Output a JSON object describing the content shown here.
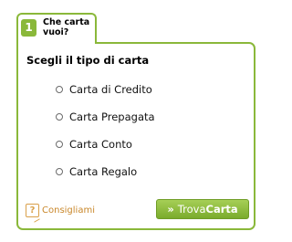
{
  "tab": {
    "step_number": "1",
    "title": "Che carta vuoi?"
  },
  "panel": {
    "heading": "Scegli il tipo di carta",
    "options": [
      {
        "label": "Carta di Credito"
      },
      {
        "label": "Carta Prepagata"
      },
      {
        "label": "Carta Conto"
      },
      {
        "label": "Carta Regalo"
      }
    ],
    "help": {
      "icon": "question-mark-icon",
      "label": "Consigliami"
    },
    "button": {
      "arrows": "»",
      "prefix": "Trova",
      "suffix": "Carta"
    }
  },
  "colors": {
    "accent": "#8ab83a",
    "help": "#d9a04a",
    "button_top": "#a6cf56",
    "button_bottom": "#7aab2c"
  }
}
